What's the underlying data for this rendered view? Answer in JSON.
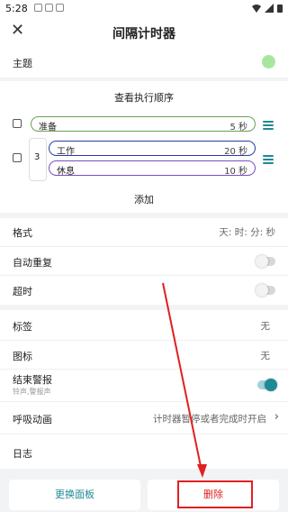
{
  "status": {
    "time": "5:28"
  },
  "appbar": {
    "title": "间隔计时器"
  },
  "theme": {
    "label": "主题",
    "color": "#a8e6a0"
  },
  "sequence": {
    "header": "查看执行顺序",
    "row1": {
      "label": "准备",
      "duration": "5 秒"
    },
    "group": {
      "repeat": "3",
      "items": [
        {
          "label": "工作",
          "duration": "20 秒"
        },
        {
          "label": "休息",
          "duration": "10 秒"
        }
      ]
    },
    "add_label": "添加"
  },
  "settings": {
    "format": {
      "label": "格式",
      "value": "天: 时: 分: 秒"
    },
    "autorepeat": {
      "label": "自动重复"
    },
    "overtime": {
      "label": "超时"
    },
    "tags": {
      "label": "标签",
      "value": "无"
    },
    "icon": {
      "label": "图标",
      "value": "无"
    },
    "end_alarm": {
      "label": "结束警报",
      "sublabel": "铃声,警报声"
    },
    "breathing": {
      "label": "呼吸动画",
      "value": "计时器暂停或者完成时开启"
    },
    "log": {
      "label": "日志"
    }
  },
  "bottom": {
    "switch_panel": "更换面板",
    "delete": "删除"
  },
  "colors": {
    "prep_border": "#6aa05a",
    "work_border": "#2b3da8",
    "rest_border": "#7a4fbf",
    "accent": "#1e8a96",
    "annotation": "#e02020"
  }
}
